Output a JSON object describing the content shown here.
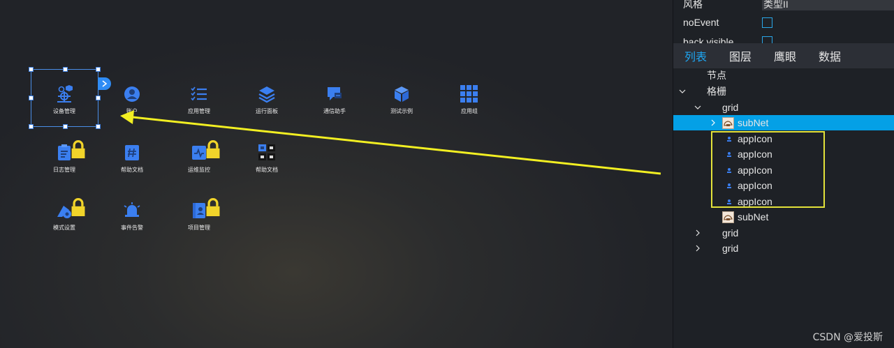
{
  "canvas": {
    "apps": [
      {
        "label": "设备管理",
        "icon": "device-management-icon",
        "locked": false
      },
      {
        "label": "账户",
        "icon": "account-icon",
        "locked": false
      },
      {
        "label": "应用管理",
        "icon": "app-management-icon",
        "locked": false
      },
      {
        "label": "运行面板",
        "icon": "layers-icon",
        "locked": false
      },
      {
        "label": "通信助手",
        "icon": "chat-icon",
        "locked": false
      },
      {
        "label": "测试示例",
        "icon": "cube-icon",
        "locked": false
      },
      {
        "label": "应用组",
        "icon": "app-group-icon",
        "locked": false
      },
      {
        "label": "日志管理",
        "icon": "log-icon",
        "locked": true
      },
      {
        "label": "帮助文档",
        "icon": "hash-book-icon",
        "locked": false
      },
      {
        "label": "运维监控",
        "icon": "monitor-icon",
        "locked": true
      },
      {
        "label": "帮助文档",
        "icon": "app-group-small-icon",
        "locked": false
      },
      {
        "label": "模式设置",
        "icon": "mode-settings-icon",
        "locked": true
      },
      {
        "label": "事件告警",
        "icon": "alarm-bell-icon",
        "locked": false
      },
      {
        "label": "项目管理",
        "icon": "project-book-icon",
        "locked": true
      }
    ]
  },
  "panel": {
    "properties": [
      {
        "name": "风格",
        "value": "类型II"
      },
      {
        "name": "noEvent",
        "checked": false
      },
      {
        "name": "back visible",
        "checked": false
      }
    ],
    "tabs": [
      "列表",
      "图层",
      "鹰眼",
      "数据"
    ],
    "active_tab": "列表",
    "tree": [
      {
        "label": "节点"
      },
      {
        "label": "格栅"
      },
      {
        "label": "grid"
      },
      {
        "label": "subNet"
      },
      {
        "label": "appIcon"
      },
      {
        "label": "appIcon"
      },
      {
        "label": "appIcon"
      },
      {
        "label": "appIcon"
      },
      {
        "label": "appIcon"
      },
      {
        "label": "subNet"
      },
      {
        "label": "grid"
      },
      {
        "label": "grid"
      }
    ]
  },
  "watermark": "CSDN @爱投斯",
  "colors": {
    "accent": "#1ea6f2",
    "icon_blue": "#3b7ff0",
    "selected_row": "#04a0e6",
    "highlight_yellow": "#e3e23a",
    "lock_yellow": "#f1d42a"
  }
}
